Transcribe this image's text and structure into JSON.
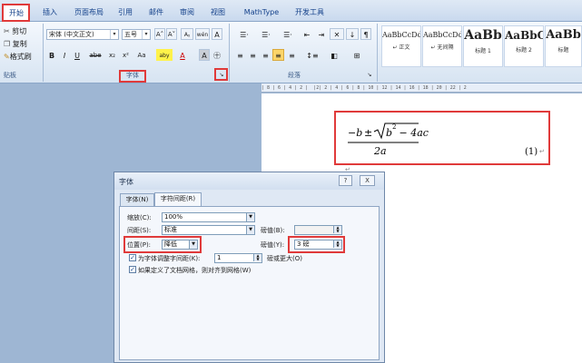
{
  "tabs": [
    "开始",
    "插入",
    "页面布局",
    "引用",
    "邮件",
    "审阅",
    "视图",
    "MathType",
    "开发工具"
  ],
  "clipboard": {
    "cut": "剪切",
    "copy": "复制",
    "painter": "格式刷",
    "group_label": "贴板"
  },
  "font": {
    "family": "宋体 (中文正文)",
    "size": "五号",
    "grow": "A˄",
    "shrink": "A˅",
    "clear": "Aᵪ",
    "wen": "wén",
    "charborder": "A",
    "bold": "B",
    "italic": "I",
    "underline": "U",
    "strike": "abe",
    "sub": "x₂",
    "sup": "x²",
    "case": "Aa",
    "highlight": "aby",
    "color": "A",
    "shade": "A",
    "enclose": "㊉",
    "group_label": "字体",
    "launcher": "↘"
  },
  "paragraph": {
    "group_label": "段落",
    "launcher": "↘"
  },
  "styles": [
    {
      "sample": "AaBbCcDd",
      "name": "↵ 正文"
    },
    {
      "sample": "AaBbCcDd",
      "name": "↵ 无间隔"
    },
    {
      "sample": "AaBb",
      "name": "标题 1"
    },
    {
      "sample": "AaBbC",
      "name": "标题 2"
    },
    {
      "sample": "AaBb",
      "name": "标题"
    }
  ],
  "ruler_text": "| 8 | 6 | 4 | 2 |  |2| 2 | 4 | 6 | 8 | 10 | 12 | 14 | 16 | 18 | 20 | 22 | 2",
  "equation": {
    "neg_b": "−b",
    "pm": "±",
    "radicand_b": "b",
    "exp": "2",
    "radicand_rest": " − 4ac",
    "denominator": "2a",
    "number": "(1)",
    "para_mark": "↵"
  },
  "dialog": {
    "title": "字体",
    "help": "?",
    "close": "X",
    "tabs": [
      "字体(N)",
      "字符间距(R)"
    ],
    "scale_label": "缩放(C):",
    "scale_value": "100%",
    "spacing_label": "间距(S):",
    "spacing_value": "标准",
    "spacing_by_label": "磅值(B):",
    "spacing_by_value": "",
    "position_label": "位置(P):",
    "position_value": "降低",
    "position_by_label": "磅值(Y):",
    "position_by_value": "3 磅",
    "kerning_label": "为字体调整字间距(K):",
    "kerning_value": "1",
    "kerning_suffix": "磅或更大(O)",
    "grid_label": "如果定义了文档网格，则对齐到网格(W)",
    "check": "✓"
  },
  "colors": {
    "highlight": "#e03a3a",
    "accent": "#15428b"
  }
}
